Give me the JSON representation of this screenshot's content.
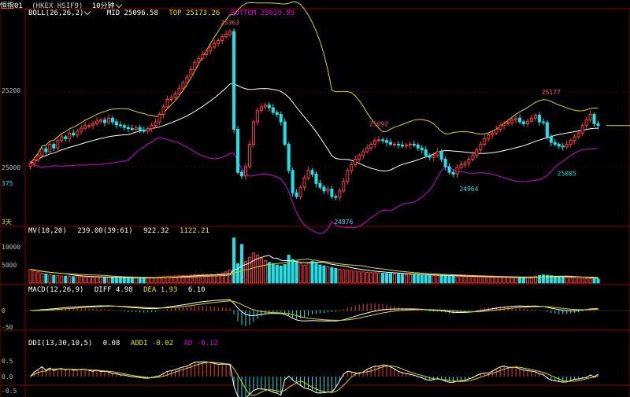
{
  "header": {
    "instrument": "恒指01",
    "code": "(HKEX HSIF9)",
    "interval": "10分钟"
  },
  "boll": {
    "name": "BOLL(26,26,2)",
    "mid": "MID 25096.58",
    "top": "TOP 25173.26",
    "bottom": "BOTTOM 25019.89"
  },
  "mv": {
    "name": "MV(10,20)",
    "v1": "239.00(39:61)",
    "v2": "922.32",
    "v3": "1122.21"
  },
  "macd": {
    "name": "MACD(12,26,9)",
    "diff": "DIFF 4.98",
    "dea": "DEA 1.93",
    "macd": "6.10"
  },
  "ddi": {
    "name": "DDI(13,30,10,5)",
    "v1": "0.08",
    "addi": "ADDI -0.02",
    "ad": "AD -0.12"
  },
  "y_labels": {
    "price": [
      "25200",
      "25000"
    ],
    "volume": [
      "10000",
      "5000"
    ],
    "macd": [
      "0",
      "-50"
    ],
    "ddi": [
      "0.5",
      "0.0",
      "-0.5"
    ]
  },
  "period_label": "3天",
  "cut_label": "375",
  "colors": {
    "up": "#ff3b3b",
    "down": "#1ee0e6",
    "mid": "#ffffff",
    "band": "#d8d800",
    "lower": "#d400d4",
    "grid": "#8a0000"
  },
  "chart_data": [
    {
      "type": "candlestick",
      "ylim": [
        24840,
        25400
      ],
      "annotations": [
        {
          "label": "25363",
          "value": 25363,
          "index": 51
        },
        {
          "label": "25092",
          "value": 25092,
          "index": 89
        },
        {
          "label": "25177",
          "value": 25177,
          "index": 133
        },
        {
          "label": "24876",
          "value": 24876,
          "index": 80
        },
        {
          "label": "24964",
          "value": 24964,
          "index": 112
        },
        {
          "label": "25005",
          "value": 25005,
          "index": 137
        }
      ],
      "close": [
        25009,
        25018,
        25030,
        25048,
        25040,
        25060,
        25050,
        25070,
        25080,
        25075,
        25090,
        25085,
        25095,
        25103,
        25110,
        25110,
        25115,
        25122,
        25125,
        25118,
        25130,
        25120,
        25112,
        25110,
        25105,
        25102,
        25100,
        25105,
        25098,
        25095,
        25102,
        25110,
        25120,
        25140,
        25160,
        25180,
        25185,
        25195,
        25210,
        25225,
        25240,
        25260,
        25280,
        25290,
        25300,
        25310,
        25320,
        25330,
        25338,
        25348,
        25355,
        25362,
        25100,
        24985,
        24975,
        25000,
        25060,
        25120,
        25150,
        25160,
        25165,
        25158,
        25145,
        25140,
        25120,
        25060,
        24990,
        24930,
        24920,
        24945,
        24970,
        24990,
        24980,
        24955,
        24945,
        24935,
        24940,
        24920,
        24918,
        24935,
        24960,
        24990,
        25005,
        25020,
        25030,
        25040,
        25050,
        25060,
        25070,
        25072,
        25070,
        25065,
        25060,
        25060,
        25058,
        25055,
        25058,
        25060,
        25058,
        25050,
        25045,
        25030,
        25025,
        25030,
        25040,
        25020,
        25000,
        24985,
        24980,
        24998,
        25005,
        25010,
        25020,
        25030,
        25045,
        25060,
        25075,
        25085,
        25090,
        25100,
        25110,
        25115,
        25118,
        25125,
        25130,
        25120,
        25115,
        25122,
        25130,
        25138,
        25120,
        25118,
        25080,
        25065,
        25060,
        25055,
        25053,
        25060,
        25070,
        25080,
        25090,
        25110,
        25125,
        25140,
        25115,
        25110
      ],
      "volume": [
        3200,
        2900,
        2600,
        2300,
        2100,
        1900,
        1800,
        1700,
        1650,
        1600,
        1550,
        1500,
        1480,
        1450,
        1420,
        1400,
        1380,
        1350,
        1330,
        1300,
        1280,
        1260,
        1240,
        1220,
        1210,
        1200,
        1190,
        1180,
        1170,
        1160,
        1150,
        1200,
        1300,
        1400,
        1500,
        1550,
        1600,
        1650,
        1700,
        1750,
        1800,
        1850,
        1900,
        1950,
        2000,
        2000,
        2000,
        1950,
        2100,
        2300,
        2600,
        3000,
        10500,
        4500,
        9000,
        5000,
        6000,
        7000,
        6500,
        5800,
        5200,
        4800,
        4500,
        4200,
        4000,
        4300,
        6500,
        5500,
        5000,
        4500,
        4200,
        4800,
        5000,
        4600,
        4200,
        4000,
        3800,
        3600,
        3400,
        3200,
        3100,
        3000,
        2900,
        2800,
        2700,
        2600,
        2500,
        2450,
        2400,
        2350,
        2300,
        2250,
        2200,
        2150,
        2100,
        2050,
        2000,
        1950,
        1900,
        1850,
        1800,
        1780,
        1750,
        1720,
        1700,
        1680,
        1650,
        1630,
        1600,
        1580,
        1550,
        1530,
        1500,
        1480,
        1450,
        1430,
        1400,
        1380,
        1360,
        1340,
        1320,
        1300,
        1280,
        1260,
        1240,
        1220,
        1200,
        1300,
        1450,
        1600,
        1750,
        1900,
        1800,
        1700,
        1600,
        1500,
        1400,
        1300,
        1200,
        1150,
        1100,
        1050,
        1000,
        980,
        950,
        920
      ]
    }
  ]
}
